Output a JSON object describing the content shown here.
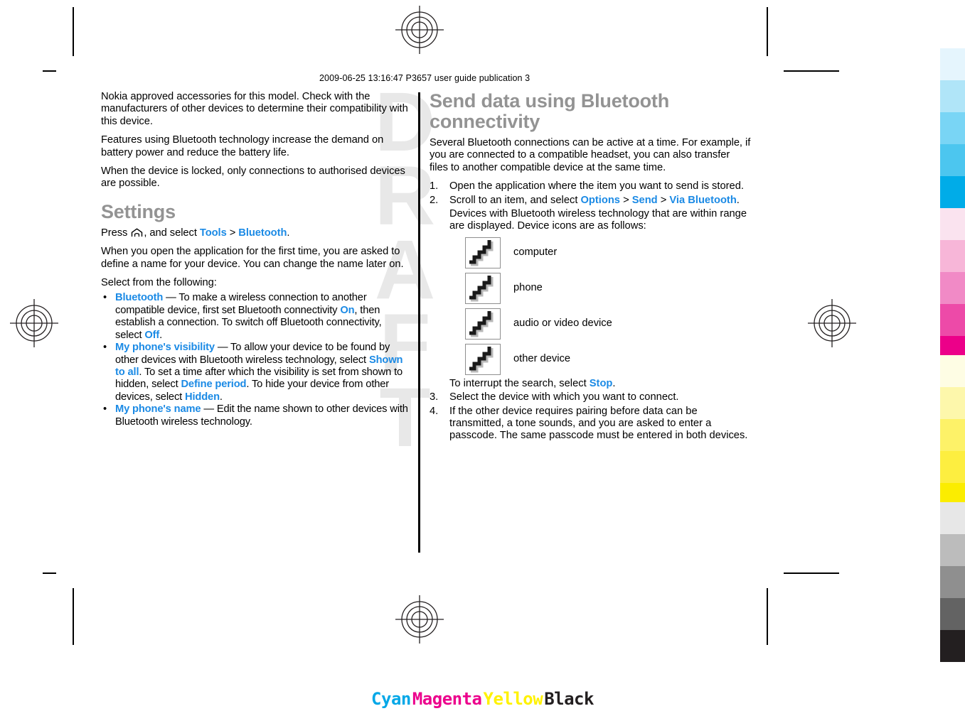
{
  "page": {
    "proof_stamp": "2009-06-25 13:16:47 P3657 user guide publication 3",
    "watermark": "DRAFT",
    "watermark_letters": [
      "D",
      "R",
      "A",
      "F",
      "T"
    ]
  },
  "left_column": {
    "paragraphs": [
      "Nokia approved accessories for this model. Check with the manufacturers of other devices to determine their compatibility with this device.",
      "Features using Bluetooth technology increase the demand on battery power and reduce the battery life.",
      "When the device is locked, only connections to authorised devices are possible."
    ],
    "heading": "Settings",
    "press_line": {
      "prefix": "Press ",
      "icon": "home-key-icon",
      "middle": ", and select ",
      "link1": "Tools",
      "separator": ">",
      "link2": "Bluetooth",
      "suffix": "."
    },
    "after_heading_paragraph": "When you open the application for the first time, you are asked to define a name for your device. You can change the name later on.",
    "select_lead": "Select from the following:",
    "bullets": [
      {
        "term": "Bluetooth",
        "dash": " — ",
        "text_parts": [
          {
            "t": "To make a wireless connection to another compatible device, first set Bluetooth connectivity "
          },
          {
            "t": "On",
            "ui": true
          },
          {
            "t": ", then establish a connection. To switch off Bluetooth connectivity, select "
          },
          {
            "t": "Off",
            "ui": true
          },
          {
            "t": "."
          }
        ]
      },
      {
        "term": "My phone's visibility",
        "dash": " — ",
        "text_parts": [
          {
            "t": "To allow your device to be found by other devices with Bluetooth wireless technology, select "
          },
          {
            "t": "Shown to all",
            "ui": true
          },
          {
            "t": ". To set a time after which the visibility is set from shown to hidden, select "
          },
          {
            "t": "Define period",
            "ui": true
          },
          {
            "t": ". To hide your device from other devices, select "
          },
          {
            "t": "Hidden",
            "ui": true
          },
          {
            "t": "."
          }
        ]
      },
      {
        "term": "My phone's name",
        "dash": " — ",
        "text_parts": [
          {
            "t": "Edit the name shown to other devices with Bluetooth wireless technology."
          }
        ]
      }
    ]
  },
  "right_column": {
    "heading": "Send data using Bluetooth connectivity",
    "intro": "Several Bluetooth connections can be active at a time. For example, if you are connected to a compatible headset, you can also transfer files to another compatible device at the same time.",
    "steps": [
      {
        "num": "1.",
        "parts": [
          {
            "t": "Open the application where the item you want to send is stored."
          }
        ]
      },
      {
        "num": "2.",
        "parts": [
          {
            "t": "Scroll to an item, and select "
          },
          {
            "t": "Options",
            "ui": true
          },
          {
            "t": " > ",
            "sep": true
          },
          {
            "t": "Send",
            "ui": true
          },
          {
            "t": " > ",
            "sep": true
          },
          {
            "t": "Via Bluetooth",
            "ui": true
          },
          {
            "t": "."
          }
        ],
        "sub": "Devices with Bluetooth wireless technology that are within range are displayed. Device icons are as follows:"
      },
      {
        "num": "3.",
        "parts": [
          {
            "t": "Select the device with which you want to connect."
          }
        ]
      },
      {
        "num": "4.",
        "parts": [
          {
            "t": "If the other device requires pairing before data can be transmitted, a tone sounds, and you are asked to enter a passcode. The same passcode must be entered in both devices."
          }
        ]
      }
    ],
    "device_icons": [
      {
        "icon": "missing-image-placeholder-icon",
        "label": "computer"
      },
      {
        "icon": "missing-image-placeholder-icon",
        "label": "phone"
      },
      {
        "icon": "missing-image-placeholder-icon",
        "label": "audio or video device"
      },
      {
        "icon": "missing-image-placeholder-icon",
        "label": "other device"
      }
    ],
    "interrupt_line": {
      "prefix": "To interrupt the search, select ",
      "link": "Stop",
      "suffix": "."
    }
  },
  "print_marks": {
    "cmyk_labels": [
      {
        "name": "Cyan",
        "color": "#00a7e7"
      },
      {
        "name": "Magenta",
        "color": "#ec008c"
      },
      {
        "name": "Yellow",
        "color": "#fff200"
      },
      {
        "name": "Black",
        "color": "#231f20"
      }
    ],
    "color_bars": [
      {
        "group": "cyan",
        "swatches": [
          "#e5f5fd",
          "#b0e5f8",
          "#79d5f5",
          "#4cc6ef",
          "#00ace8"
        ]
      },
      {
        "group": "magenta",
        "swatches": [
          "#fae3ef",
          "#f7b6d8",
          "#f18ac6",
          "#ed4aa8",
          "#ec0089"
        ]
      },
      {
        "group": "yellow",
        "swatches": [
          "#fefde4",
          "#fdf7ab",
          "#fdf268",
          "#fdee40",
          "#fbed00"
        ]
      },
      {
        "group": "black",
        "swatches": [
          "#e7e7e7",
          "#bcbcbc",
          "#8f8f8f",
          "#636363",
          "#231f20"
        ]
      }
    ],
    "registration_marks": 4,
    "crop_marks": 8
  }
}
